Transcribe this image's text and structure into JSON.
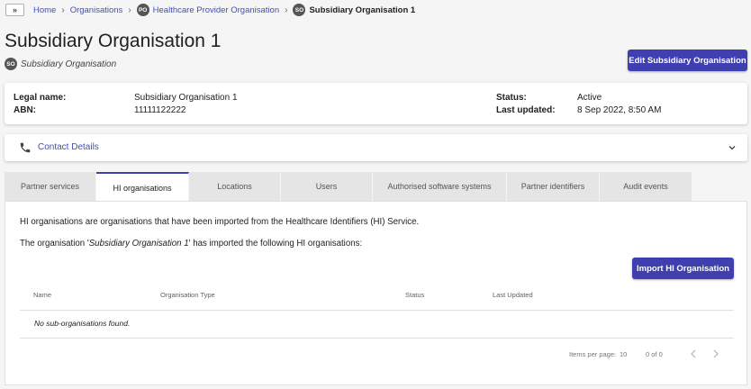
{
  "breadcrumb": {
    "expand_glyph": "»",
    "home": "Home",
    "organisations": "Organisations",
    "parent_badge": "PO",
    "parent": "Healthcare Provider Organisation",
    "current_badge": "SO",
    "current": "Subsidiary Organisation 1"
  },
  "header": {
    "title": "Subsidiary Organisation 1",
    "badge": "SO",
    "subtitle": "Subsidiary Organisation",
    "edit_button": "Edit Subsidiary Organisation"
  },
  "info": {
    "legal_name_label": "Legal name:",
    "legal_name": "Subsidiary Organisation 1",
    "abn_label": "ABN:",
    "abn": "11111122222",
    "status_label": "Status:",
    "status": "Active",
    "updated_label": "Last updated:",
    "updated": "8 Sep 2022, 8:50 AM"
  },
  "contact": {
    "title": "Contact Details",
    "icon": "phone-icon"
  },
  "tabs": [
    {
      "label": "Partner services"
    },
    {
      "label": "HI organisations"
    },
    {
      "label": "Locations"
    },
    {
      "label": "Users"
    },
    {
      "label": "Authorised software systems"
    },
    {
      "label": "Partner identifiers"
    },
    {
      "label": "Audit events"
    }
  ],
  "active_tab": "HI organisations",
  "content": {
    "intro": "HI organisations are organisations that have been imported from the Healthcare Identifiers (HI) Service.",
    "line2_prefix": "The organisation '",
    "line2_name": "Subsidiary Organisation 1",
    "line2_suffix": "' has imported the following HI organisations:",
    "import_button": "Import HI Organisation",
    "columns": [
      "Name",
      "Organisation Type",
      "Status",
      "Last Updated"
    ],
    "empty_message": "No sub-organisations found.",
    "paginator": {
      "items_per_page_label": "Items per page:",
      "items_per_page": "10",
      "range": "0 of 0"
    }
  },
  "colors": {
    "accent": "#3f3fb0",
    "link": "#3f51b5"
  }
}
